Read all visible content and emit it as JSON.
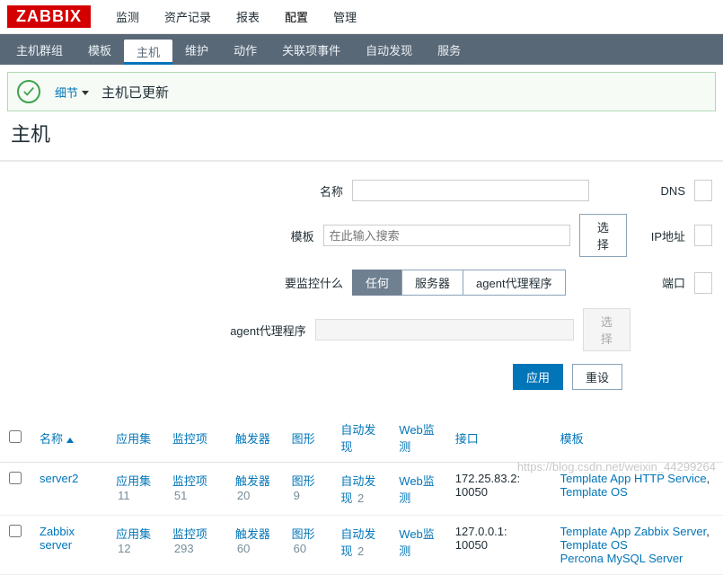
{
  "brand": "ZABBIX",
  "topnav": [
    "监测",
    "资产记录",
    "报表",
    "配置",
    "管理"
  ],
  "topnav_active": 3,
  "subnav": [
    "主机群组",
    "模板",
    "主机",
    "维护",
    "动作",
    "关联项事件",
    "自动发现",
    "服务"
  ],
  "subnav_active": 2,
  "notice": {
    "detail": "细节",
    "message": "主机已更新"
  },
  "page_title": "主机",
  "filter": {
    "labels": {
      "name": "名称",
      "template": "模板",
      "monitor_what": "要监控什么",
      "agent": "agent代理程序",
      "dns": "DNS",
      "ip": "IP地址",
      "port": "端口"
    },
    "template_placeholder": "在此输入搜索",
    "select": "选择",
    "monitor_options": [
      "任何",
      "服务器",
      "agent代理程序"
    ],
    "monitor_active": 0,
    "apply": "应用",
    "reset": "重设"
  },
  "columns": [
    "",
    "名称",
    "应用集",
    "监控项",
    "触发器",
    "图形",
    "自动发现",
    "Web监测",
    "接口",
    "模板"
  ],
  "sort_col": 1,
  "rows": [
    {
      "name": "server2",
      "apps": {
        "t": "应用集",
        "n": 11
      },
      "items": {
        "t": "监控项",
        "n": 51
      },
      "triggers": {
        "t": "触发器",
        "n": 20
      },
      "graphs": {
        "t": "图形",
        "n": 9
      },
      "disc": {
        "t": "自动发现",
        "n": 2
      },
      "web": "Web监测",
      "iface": "172.25.83.2: 10050",
      "templates": [
        {
          "t": "Template App HTTP Service"
        },
        {
          "t": "Template OS"
        }
      ]
    },
    {
      "name": "Zabbix server",
      "apps": {
        "t": "应用集",
        "n": 12
      },
      "items": {
        "t": "监控项",
        "n": 293
      },
      "triggers": {
        "t": "触发器",
        "n": 60
      },
      "graphs": {
        "t": "图形",
        "n": 60
      },
      "disc": {
        "t": "自动发现",
        "n": 2
      },
      "web": "Web监测",
      "iface": "127.0.0.1: 10050",
      "templates": [
        {
          "t": "Template App Zabbix Server"
        },
        {
          "t": "Template OS"
        }
      ],
      "extra": "Percona MySQL Server"
    }
  ],
  "watermark": "https://blog.csdn.net/weixin_44299264"
}
